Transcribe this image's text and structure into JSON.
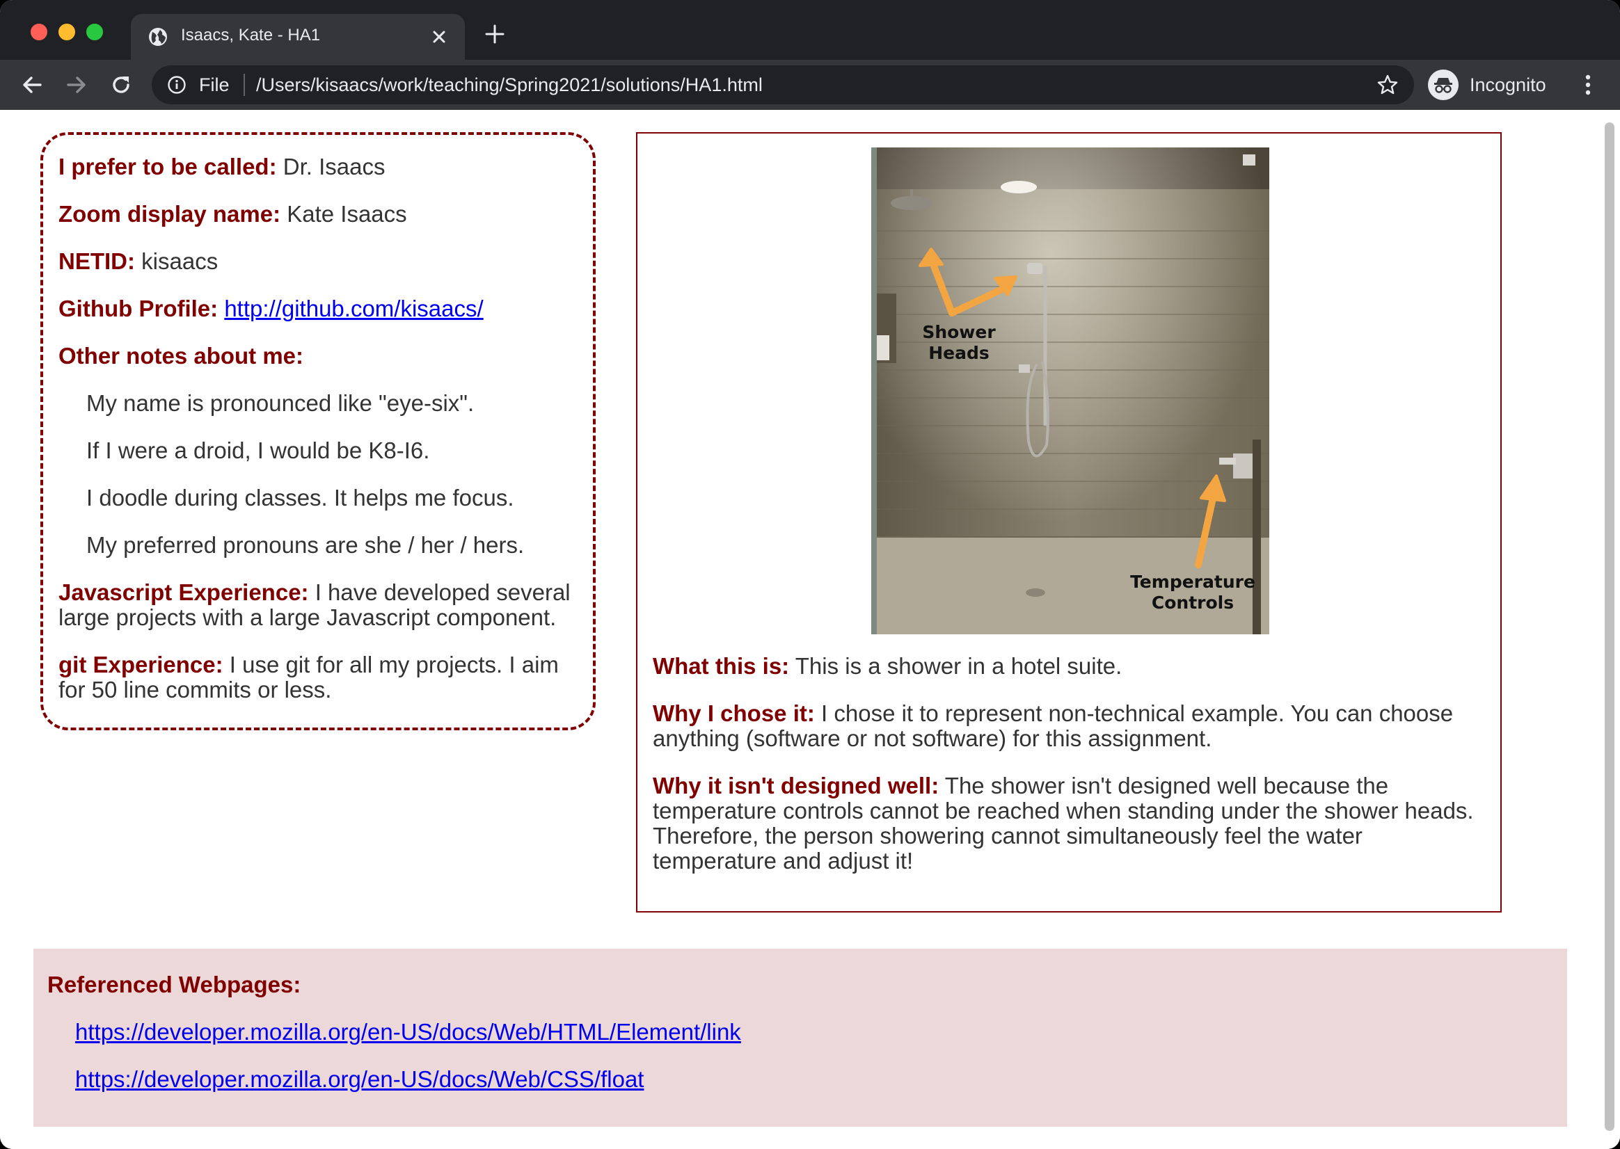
{
  "browser": {
    "tab_title": "Isaacs, Kate - HA1",
    "url_scheme": "File",
    "url": "/Users/kisaacs/work/teaching/Spring2021/solutions/HA1.html",
    "profile_label": "Incognito"
  },
  "profile": {
    "called_label": "I prefer to be called:",
    "called_value": "Dr. Isaacs",
    "zoom_label": "Zoom display name:",
    "zoom_value": "Kate Isaacs",
    "netid_label": "NETID:",
    "netid_value": "kisaacs",
    "github_label": "Github Profile:",
    "github_value": "http://github.com/kisaacs/",
    "notes_label": "Other notes about me:",
    "notes": [
      "My name is pronounced like \"eye-six\".",
      "If I were a droid, I would be K8-I6.",
      "I doodle during classes. It helps me focus.",
      "My preferred pronouns are she / her / hers."
    ],
    "js_label": "Javascript Experience:",
    "js_value": "I have developed several large projects with a large Javascript component.",
    "git_label": "git Experience:",
    "git_value": "I use git for all my projects. I aim for 50 line commits or less."
  },
  "design": {
    "photo_caption_heads": [
      "Shower",
      "Heads"
    ],
    "photo_caption_controls": [
      "Temperature",
      "Controls"
    ],
    "what_label": "What this is:",
    "what_value": "This is a shower in a hotel suite.",
    "why_label": "Why I chose it:",
    "why_value": "I chose it to represent non-technical example. You can choose anything (software or not software) for this assignment.",
    "bad_label": "Why it isn't designed well:",
    "bad_value": "The shower isn't designed well because the temperature controls cannot be reached when standing under the shower heads. Therefore, the person showering cannot simultaneously feel the water temperature and adjust it!"
  },
  "references": {
    "title": "Referenced Webpages:",
    "links": [
      "https://developer.mozilla.org/en-US/docs/Web/HTML/Element/link",
      "https://developer.mozilla.org/en-US/docs/Web/CSS/float"
    ]
  },
  "colors": {
    "accent": "#800000",
    "references_bg": "#ecd8d8",
    "link": "#0000ee"
  }
}
